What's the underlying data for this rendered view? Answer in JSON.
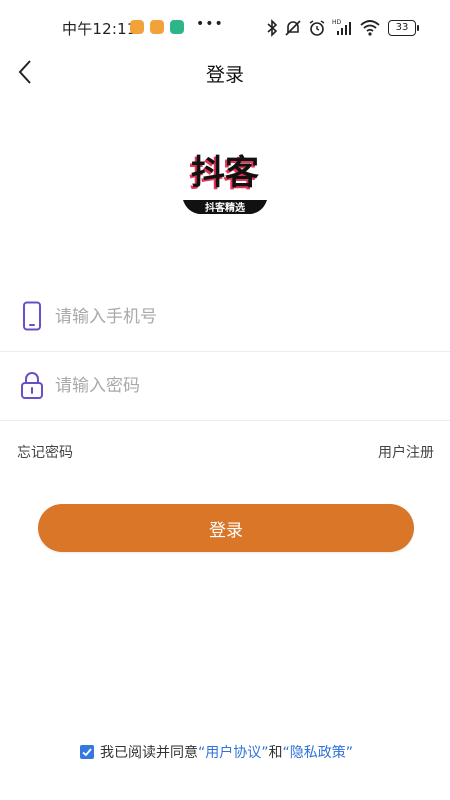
{
  "status": {
    "time": "中午12:11",
    "more": "•••",
    "battery": "33"
  },
  "nav": {
    "title": "登录"
  },
  "logo": {
    "main": "抖客",
    "sub": "抖客精选"
  },
  "form": {
    "phone_placeholder": "请输入手机号",
    "password_placeholder": "请输入密码"
  },
  "links": {
    "forgot": "忘记密码",
    "register": "用户注册"
  },
  "login_button": "登录",
  "agreement": {
    "prefix": "我已阅读并同意",
    "user_agreement": "“用户协议”",
    "and": "和",
    "privacy_policy": "“隐私政策”",
    "checked": true
  },
  "colors": {
    "accent": "#d97628",
    "icon_purple": "#6a4fc7",
    "link_blue": "#2f73d9",
    "checkbox_blue": "#3478e0"
  }
}
